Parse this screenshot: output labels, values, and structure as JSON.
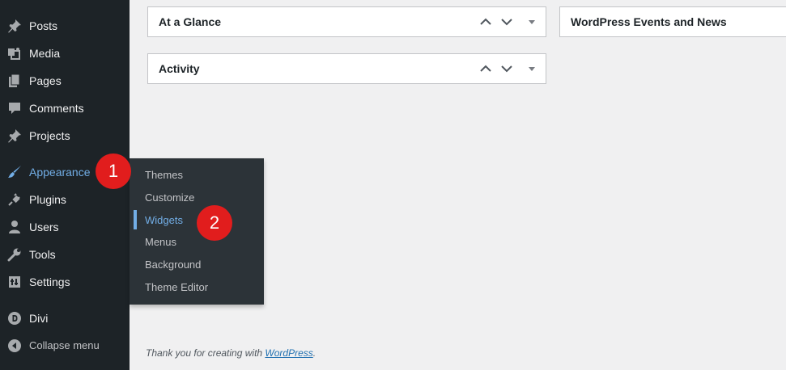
{
  "sidebar": {
    "items": [
      {
        "label": "Posts",
        "icon": "pin-icon"
      },
      {
        "label": "Media",
        "icon": "media-icon"
      },
      {
        "label": "Pages",
        "icon": "pages-icon"
      },
      {
        "label": "Comments",
        "icon": "comment-icon"
      },
      {
        "label": "Projects",
        "icon": "pin-icon"
      },
      {
        "label": "Appearance",
        "icon": "paintbrush-icon"
      },
      {
        "label": "Plugins",
        "icon": "plug-icon"
      },
      {
        "label": "Users",
        "icon": "user-icon"
      },
      {
        "label": "Tools",
        "icon": "wrench-icon"
      },
      {
        "label": "Settings",
        "icon": "settings-icon"
      },
      {
        "label": "Divi",
        "icon": "divi-icon"
      },
      {
        "label": "Collapse menu",
        "icon": "collapse-icon"
      }
    ],
    "active_color": "#72aee6",
    "background": "#1d2327"
  },
  "flyout": {
    "items": [
      "Themes",
      "Customize",
      "Widgets",
      "Menus",
      "Background",
      "Theme Editor"
    ],
    "current": "Widgets"
  },
  "badges": {
    "one": "1",
    "two": "2",
    "color": "#e11d1d"
  },
  "widgets": {
    "at_a_glance": "At a Glance",
    "activity": "Activity",
    "events": "WordPress Events and News"
  },
  "footer": {
    "prefix": "Thank you for creating with ",
    "link": "WordPress",
    "suffix": "."
  }
}
